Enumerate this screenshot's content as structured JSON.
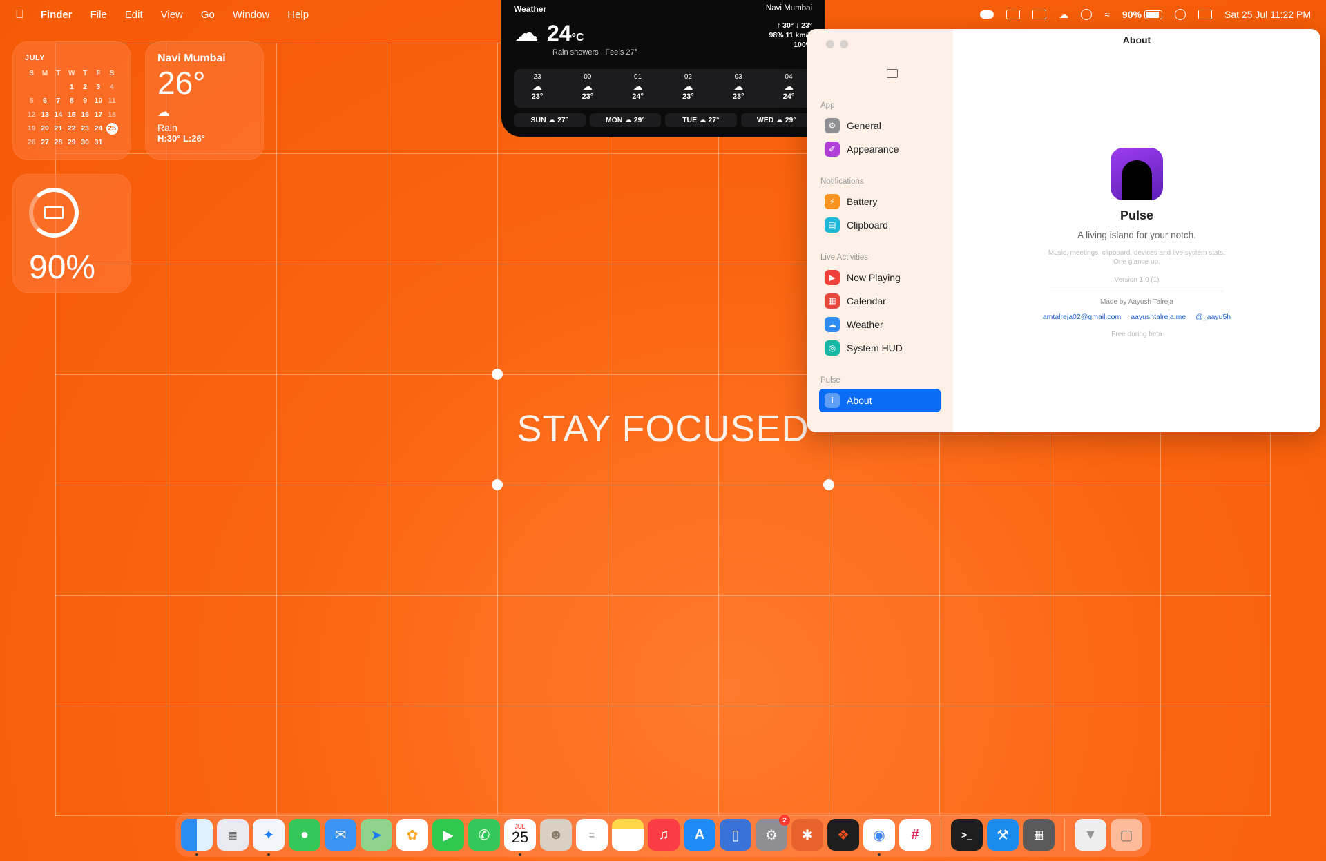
{
  "menubar": {
    "app": "Finder",
    "menus": [
      "File",
      "Edit",
      "View",
      "Go",
      "Window",
      "Help"
    ],
    "battery_pct": "90%",
    "battery_level": 0.9,
    "datetime": "Sat 25 Jul  11:22 PM"
  },
  "calendar_widget": {
    "month": "JULY",
    "weekdays": [
      "S",
      "M",
      "T",
      "W",
      "T",
      "F",
      "S"
    ],
    "weeks": [
      [
        "",
        "",
        "",
        "1",
        "2",
        "3",
        "4"
      ],
      [
        "5",
        "6",
        "7",
        "8",
        "9",
        "10",
        "11"
      ],
      [
        "12",
        "13",
        "14",
        "15",
        "16",
        "17",
        "18"
      ],
      [
        "19",
        "20",
        "21",
        "22",
        "23",
        "24",
        "25"
      ],
      [
        "26",
        "27",
        "28",
        "29",
        "30",
        "31",
        ""
      ]
    ],
    "today": "25"
  },
  "weather_widget": {
    "city": "Navi Mumbai",
    "temp": "26°",
    "condition": "Rain",
    "hilo": "H:30° L:26°"
  },
  "battery_widget": {
    "percent": "90%",
    "level": 0.9
  },
  "notch_weather": {
    "title": "Weather",
    "location": "Navi Mumbai",
    "temp": "24",
    "unit": "°C",
    "summary": "Rain showers · Feels 27°",
    "hi_lo": "↑ 30°  ↓ 23°",
    "humidity_wind": "98%  11 km/h",
    "precip": "100%",
    "hourly": [
      {
        "hour": "23",
        "temp": "23°"
      },
      {
        "hour": "00",
        "temp": "23°"
      },
      {
        "hour": "01",
        "temp": "24°"
      },
      {
        "hour": "02",
        "temp": "23°"
      },
      {
        "hour": "03",
        "temp": "23°"
      },
      {
        "hour": "04",
        "temp": "24°"
      }
    ],
    "daily": [
      {
        "day": "SUN",
        "temp": "27°"
      },
      {
        "day": "MON",
        "temp": "29°"
      },
      {
        "day": "TUE",
        "temp": "27°"
      },
      {
        "day": "WED",
        "temp": "29°"
      }
    ]
  },
  "desktop": {
    "focus_text": "STAY FOCUSED"
  },
  "settings": {
    "window_title": "About",
    "sections": {
      "app": "App",
      "notifications": "Notifications",
      "live": "Live Activities",
      "pulse": "Pulse"
    },
    "items": {
      "general": "General",
      "appearance": "Appearance",
      "battery": "Battery",
      "clipboard": "Clipboard",
      "now_playing": "Now Playing",
      "calendar": "Calendar",
      "weather": "Weather",
      "system_hud": "System HUD",
      "about": "About"
    },
    "about": {
      "app_name": "Pulse",
      "tagline": "A living island for your notch.",
      "desc1": "Music, meetings, clipboard, devices and live system stats.",
      "desc2": "One glance up.",
      "version": "Version 1.0 (1)",
      "made_by": "Made by Aayush Talreja",
      "email": "amtalreja02@gmail.com",
      "site": "aayushtalreja.me",
      "handle": "@_aayu5h",
      "footer": "Free during beta"
    },
    "accent": "#0a6cf5"
  },
  "dock": {
    "calendar_day": "25",
    "calendar_month": "JUL",
    "settings_badge": "2"
  }
}
